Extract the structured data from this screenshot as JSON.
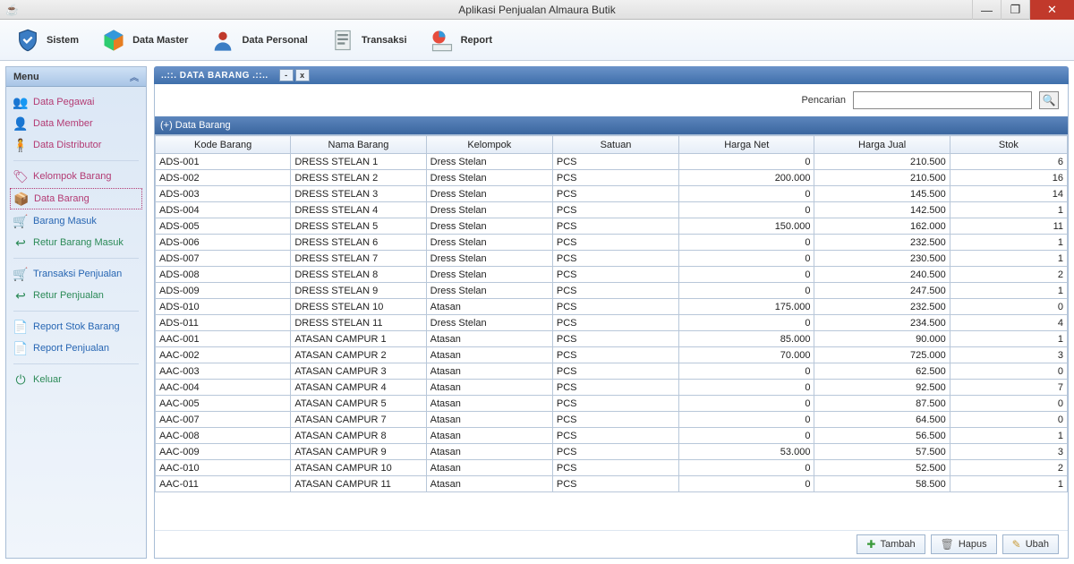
{
  "titlebar": {
    "title": "Aplikasi Penjualan Almaura Butik"
  },
  "toolbar": [
    {
      "label": "Sistem",
      "icon": "shield"
    },
    {
      "label": "Data Master",
      "icon": "cube"
    },
    {
      "label": "Data Personal",
      "icon": "person"
    },
    {
      "label": "Transaksi",
      "icon": "doc"
    },
    {
      "label": "Report",
      "icon": "chart"
    }
  ],
  "sidebar": {
    "title": "Menu",
    "groups": [
      [
        {
          "label": "Data Pegawai",
          "class": "",
          "icon": "users"
        },
        {
          "label": "Data Member",
          "class": "",
          "icon": "user"
        },
        {
          "label": "Data Distributor",
          "class": "",
          "icon": "truck-user"
        }
      ],
      [
        {
          "label": "Kelompok Barang",
          "class": "",
          "icon": "tags"
        },
        {
          "label": "Data Barang",
          "class": "active",
          "icon": "box"
        },
        {
          "label": "Barang Masuk",
          "class": "blue",
          "icon": "cart"
        },
        {
          "label": "Retur Barang Masuk",
          "class": "green",
          "icon": "return"
        }
      ],
      [
        {
          "label": "Transaksi Penjualan",
          "class": "blue",
          "icon": "cart"
        },
        {
          "label": "Retur Penjualan",
          "class": "green",
          "icon": "return"
        }
      ],
      [
        {
          "label": "Report Stok Barang",
          "class": "blue",
          "icon": "report"
        },
        {
          "label": "Report Penjualan",
          "class": "blue",
          "icon": "report"
        }
      ],
      [
        {
          "label": "Keluar",
          "class": "green",
          "icon": "exit"
        }
      ]
    ]
  },
  "tab": {
    "title": "..::. DATA BARANG .::..",
    "minimize": "-",
    "close": "x"
  },
  "search": {
    "label": "Pencarian",
    "value": ""
  },
  "sub_header": "(+) Data Barang",
  "table": {
    "headers": [
      "Kode Barang",
      "Nama Barang",
      "Kelompok",
      "Satuan",
      "Harga Net",
      "Harga Jual",
      "Stok"
    ],
    "widths": [
      150,
      150,
      140,
      140,
      150,
      150,
      130
    ],
    "numeric_cols": [
      4,
      5,
      6
    ],
    "rows": [
      [
        "ADS-001",
        "DRESS STELAN 1",
        "Dress Stelan",
        "PCS",
        "0",
        "210.500",
        "6"
      ],
      [
        "ADS-002",
        "DRESS STELAN 2",
        "Dress Stelan",
        "PCS",
        "200.000",
        "210.500",
        "16"
      ],
      [
        "ADS-003",
        "DRESS STELAN 3",
        "Dress Stelan",
        "PCS",
        "0",
        "145.500",
        "14"
      ],
      [
        "ADS-004",
        "DRESS STELAN 4",
        "Dress Stelan",
        "PCS",
        "0",
        "142.500",
        "1"
      ],
      [
        "ADS-005",
        "DRESS STELAN 5",
        "Dress Stelan",
        "PCS",
        "150.000",
        "162.000",
        "11"
      ],
      [
        "ADS-006",
        "DRESS STELAN 6",
        "Dress Stelan",
        "PCS",
        "0",
        "232.500",
        "1"
      ],
      [
        "ADS-007",
        "DRESS STELAN 7",
        "Dress Stelan",
        "PCS",
        "0",
        "230.500",
        "1"
      ],
      [
        "ADS-008",
        "DRESS STELAN 8",
        "Dress Stelan",
        "PCS",
        "0",
        "240.500",
        "2"
      ],
      [
        "ADS-009",
        "DRESS STELAN 9",
        "Dress Stelan",
        "PCS",
        "0",
        "247.500",
        "1"
      ],
      [
        "ADS-010",
        "DRESS STELAN 10",
        "Atasan",
        "PCS",
        "175.000",
        "232.500",
        "0"
      ],
      [
        "ADS-011",
        "DRESS STELAN 11",
        "Dress Stelan",
        "PCS",
        "0",
        "234.500",
        "4"
      ],
      [
        "AAC-001",
        "ATASAN CAMPUR 1",
        "Atasan",
        "PCS",
        "85.000",
        "90.000",
        "1"
      ],
      [
        "AAC-002",
        "ATASAN CAMPUR 2",
        "Atasan",
        "PCS",
        "70.000",
        "725.000",
        "3"
      ],
      [
        "AAC-003",
        "ATASAN CAMPUR 3",
        "Atasan",
        "PCS",
        "0",
        "62.500",
        "0"
      ],
      [
        "AAC-004",
        "ATASAN CAMPUR 4",
        "Atasan",
        "PCS",
        "0",
        "92.500",
        "7"
      ],
      [
        "AAC-005",
        "ATASAN CAMPUR 5",
        "Atasan",
        "PCS",
        "0",
        "87.500",
        "0"
      ],
      [
        "AAC-007",
        "ATASAN CAMPUR 7",
        "Atasan",
        "PCS",
        "0",
        "64.500",
        "0"
      ],
      [
        "AAC-008",
        "ATASAN CAMPUR 8",
        "Atasan",
        "PCS",
        "0",
        "56.500",
        "1"
      ],
      [
        "AAC-009",
        "ATASAN CAMPUR 9",
        "Atasan",
        "PCS",
        "53.000",
        "57.500",
        "3"
      ],
      [
        "AAC-010",
        "ATASAN CAMPUR 10",
        "Atasan",
        "PCS",
        "0",
        "52.500",
        "2"
      ],
      [
        "AAC-011",
        "ATASAN CAMPUR 11",
        "Atasan",
        "PCS",
        "0",
        "58.500",
        "1"
      ]
    ]
  },
  "buttons": {
    "add": "Tambah",
    "delete": "Hapus",
    "edit": "Ubah"
  }
}
